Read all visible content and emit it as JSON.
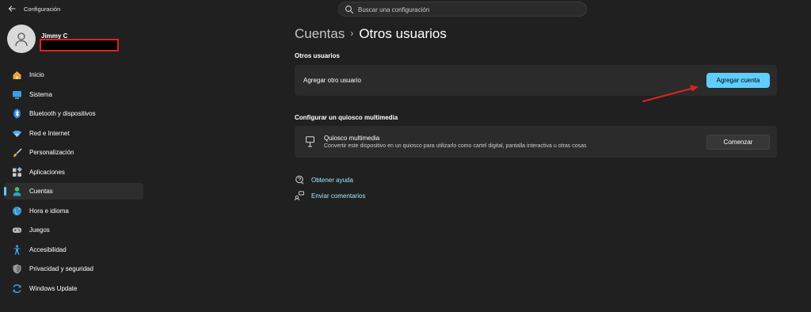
{
  "app": {
    "title": "Configuración"
  },
  "search": {
    "placeholder": "Buscar una configuración"
  },
  "profile": {
    "name": "Jimmy C"
  },
  "sidebar": {
    "items": [
      {
        "label": "Inicio",
        "icon": "home-icon"
      },
      {
        "label": "Sistema",
        "icon": "monitor-icon"
      },
      {
        "label": "Bluetooth y dispositivos",
        "icon": "bluetooth-icon"
      },
      {
        "label": "Red e Internet",
        "icon": "wifi-icon"
      },
      {
        "label": "Personalización",
        "icon": "brush-icon"
      },
      {
        "label": "Aplicaciones",
        "icon": "apps-icon"
      },
      {
        "label": "Cuentas",
        "icon": "account-icon",
        "active": true
      },
      {
        "label": "Hora e idioma",
        "icon": "globe-icon"
      },
      {
        "label": "Juegos",
        "icon": "gamepad-icon"
      },
      {
        "label": "Accesibilidad",
        "icon": "accessibility-icon"
      },
      {
        "label": "Privacidad y seguridad",
        "icon": "shield-icon"
      },
      {
        "label": "Windows Update",
        "icon": "update-icon"
      }
    ]
  },
  "breadcrumb": {
    "parent": "Cuentas",
    "separator": "›",
    "current": "Otros usuarios"
  },
  "other_users": {
    "title": "Otros usuarios",
    "add_label": "Agregar otro usuario",
    "add_button": "Agregar cuenta"
  },
  "kiosk": {
    "title": "Configurar un quiosco multimedia",
    "label": "Quiosco multimedia",
    "description": "Convertir este dispositivo en un quiosco para utilizarlo como cartel digital, pantalla interactiva u otras cosas",
    "button": "Comenzar"
  },
  "links": {
    "help": "Obtener ayuda",
    "feedback": "Enviar comentarios"
  },
  "colors": {
    "accent": "#60cdff",
    "background": "#202020",
    "card": "#2b2b2b",
    "annotation": "#e02020"
  }
}
